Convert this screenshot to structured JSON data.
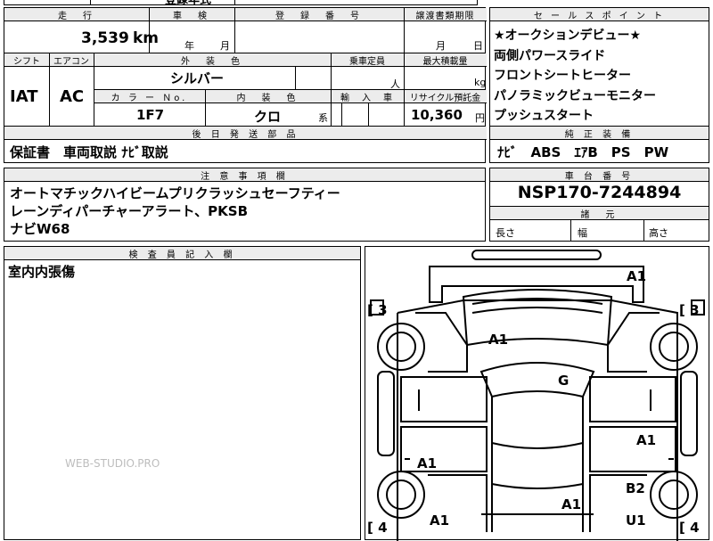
{
  "top_row": {
    "c1": "",
    "c2": "",
    "c3": "登録年式",
    "c4": ""
  },
  "mileage": {
    "label": "走　行",
    "value": "3,539",
    "unit": "km"
  },
  "shaken": {
    "label": "車　検",
    "year": "年",
    "month": "月"
  },
  "registration": {
    "label": "登　録　番　号",
    "value": ""
  },
  "transfer_deadline": {
    "label": "譲渡書類期限",
    "month": "月",
    "day": "日"
  },
  "shift": {
    "label": "シフト",
    "value": "IAT"
  },
  "aircon": {
    "label": "エアコン",
    "value": "AC"
  },
  "exterior_color": {
    "label": "外　装　色",
    "value": "シルバー"
  },
  "capacity": {
    "label": "乗車定員",
    "unit": "人"
  },
  "max_load": {
    "label": "最大積載量",
    "unit": "kg"
  },
  "color_no": {
    "label": "カ ラ ー Ｎo.",
    "value": "1F7"
  },
  "interior_color": {
    "label": "内　装　色",
    "value": "クロ",
    "suffix": "系"
  },
  "import": {
    "label": "輸　入　車"
  },
  "recycle": {
    "label": "リサイクル預託金",
    "value": "10,360",
    "unit": "円"
  },
  "later_parts": {
    "label": "後 日 発 送 部 品",
    "value": "保証書　車両取説 ﾅﾋﾞ取説"
  },
  "sales_points": {
    "label": "セ ー ル ス ポ イ ン ト",
    "items": [
      "★オークションデビュー★",
      "両側パワースライド",
      "フロントシートヒーター",
      "パノラミックビューモニター",
      "プッシュスタート"
    ]
  },
  "genuine_equipment": {
    "label": "純 正 装 備",
    "value": "ﾅﾋﾞ　ABS　ｴｱB　PS　PW"
  },
  "notes": {
    "label": "注 意 事 項 欄",
    "lines": [
      "オートマチックハイビームプリクラッシュセーフティー",
      "レーンディパーチャーアラート、PKSB",
      "ナビW68"
    ]
  },
  "chassis_no": {
    "label": "車 台 番 号",
    "value": "NSP170-7244894"
  },
  "dimensions": {
    "label": "諸　元",
    "length": "長さ",
    "width": "幅",
    "height": "高さ"
  },
  "inspector": {
    "label": "検 査 員 記 入 欄",
    "value": "室内内張傷"
  },
  "watermark": "WEB-STUDIO.PRO",
  "diagram_marks": {
    "a1_top_right": "A1",
    "a1_hood": "A1",
    "g_windshield": "G",
    "a1_right_front_door": "A1",
    "a1_left_rear_door": "A1",
    "b2_right": "B2",
    "a1_roof_rear": "A1",
    "a1_bottom_left": "A1",
    "u1_bottom_right": "U1",
    "bracket_left_top": "[ 3",
    "bracket_right_top": "[ 3",
    "bracket_left_bottom": "[ 4",
    "bracket_right_bottom": "[ 4"
  }
}
